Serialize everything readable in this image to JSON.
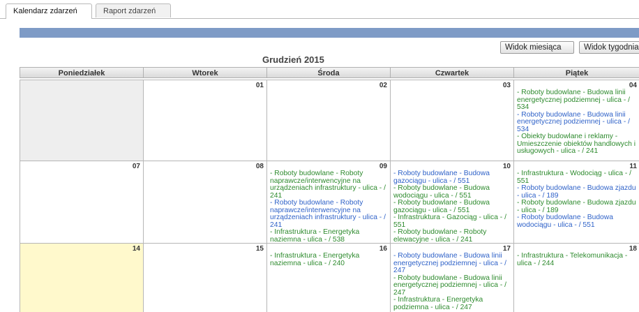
{
  "tabs": [
    {
      "label": "Kalendarz zdarzeń",
      "active": true
    },
    {
      "label": "Raport zdarzeń",
      "active": false
    }
  ],
  "toolbar": {
    "month_view": "Widok miesiąca",
    "week_view": "Widok tygodnia"
  },
  "calendar": {
    "title": "Grudzień 2015",
    "weekdays": [
      "Poniedziałek",
      "Wtorek",
      "Środa",
      "Czwartek",
      "Piątek"
    ],
    "colors": {
      "green": "#2d8a2d",
      "blue": "#2f62c8",
      "today": "#fff9cc",
      "header_bar": "#7e9bc6"
    },
    "weeks": [
      {
        "days": [
          {
            "day": "",
            "events": []
          },
          {
            "day": "01",
            "events": []
          },
          {
            "day": "02",
            "events": []
          },
          {
            "day": "03",
            "events": []
          },
          {
            "day": "04",
            "events": [
              {
                "text": "- Roboty budowlane - Budowa linii energetycznej podziemnej - ulica - / 534",
                "color": "g"
              },
              {
                "text": "- Roboty budowlane - Budowa linii energetycznej podziemnej - ulica - / 534",
                "color": "b"
              },
              {
                "text": "- Obiekty budowlane i reklamy - Umieszczenie obiektów handlowych i usługowych - ulica - / 241",
                "color": "g"
              }
            ]
          }
        ]
      },
      {
        "days": [
          {
            "day": "07",
            "events": []
          },
          {
            "day": "08",
            "events": []
          },
          {
            "day": "09",
            "events": [
              {
                "text": "- Roboty budowlane - Roboty naprawcze/interwencyjne na urządzeniach infrastruktury - ulica - / 241",
                "color": "g"
              },
              {
                "text": "- Roboty budowlane - Roboty naprawcze/interwencyjne na urządzeniach infrastruktury - ulica - / 241",
                "color": "b"
              },
              {
                "text": "- Infrastruktura - Energetyka naziemna - ulica - / 538",
                "color": "g"
              }
            ]
          },
          {
            "day": "10",
            "events": [
              {
                "text": "- Roboty budowlane - Budowa gazociągu - ulica - / 551",
                "color": "b"
              },
              {
                "text": "- Roboty budowlane - Budowa wodociągu - ulica - / 551",
                "color": "g"
              },
              {
                "text": "- Roboty budowlane - Budowa gazociągu - ulica - / 551",
                "color": "g"
              },
              {
                "text": "- Infrastruktura - Gazociąg - ulica - / 551",
                "color": "g"
              },
              {
                "text": "- Roboty budowlane - Roboty elewacyjne - ulica - / 241",
                "color": "g"
              }
            ]
          },
          {
            "day": "11",
            "events": [
              {
                "text": "- Infrastruktura - Wodociąg - ulica - / 551",
                "color": "g"
              },
              {
                "text": "- Roboty budowlane - Budowa zjazdu - ulica - / 189",
                "color": "b"
              },
              {
                "text": "- Roboty budowlane - Budowa zjazdu - ulica - / 189",
                "color": "g"
              },
              {
                "text": "- Roboty budowlane - Budowa wodociągu - ulica - / 551",
                "color": "b"
              }
            ]
          }
        ]
      },
      {
        "days": [
          {
            "day": "14",
            "events": []
          },
          {
            "day": "15",
            "events": []
          },
          {
            "day": "16",
            "events": [
              {
                "text": "- Infrastruktura - Energetyka naziemna - ulica - / 240",
                "color": "g"
              }
            ]
          },
          {
            "day": "17",
            "events": [
              {
                "text": "- Roboty budowlane - Budowa linii energetycznej podziemnej - ulica - / 247",
                "color": "b"
              },
              {
                "text": "- Roboty budowlane - Budowa linii energetycznej podziemnej - ulica - / 247",
                "color": "g"
              },
              {
                "text": "- Infrastruktura - Energetyka podziemna - ulica - / 247",
                "color": "g"
              }
            ]
          },
          {
            "day": "18",
            "events": [
              {
                "text": "- Infrastruktura - Telekomunikacja - ulica - / 244",
                "color": "g"
              }
            ]
          }
        ]
      }
    ]
  }
}
